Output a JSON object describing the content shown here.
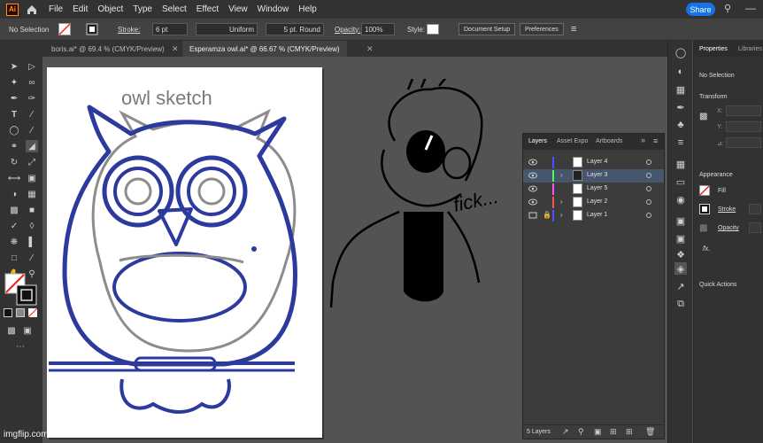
{
  "app": {
    "logo_text": "Ai"
  },
  "menu": [
    "File",
    "Edit",
    "Object",
    "Type",
    "Select",
    "Effect",
    "View",
    "Window",
    "Help"
  ],
  "share_label": "Share",
  "control_bar": {
    "selection": "No Selection",
    "stroke_label": "Stroke:",
    "stroke_weight": "6 pt",
    "profile": "Uniform",
    "brush": "5 pt. Round",
    "opacity_label": "Opacity:",
    "opacity": "100%",
    "style_label": "Style:",
    "document_setup": "Document Setup",
    "preferences": "Preferences"
  },
  "tabs": [
    {
      "label": "boris.ai* @ 69.4 % (CMYK/Preview)",
      "active": false
    },
    {
      "label": "Esperamza owl.ai* @ 66.67 % (CMYK/Preview)",
      "active": true
    }
  ],
  "artboard": {
    "title_text": "owl sketch"
  },
  "canvas": {
    "doodle_text": "fick..."
  },
  "properties": {
    "tab_properties": "Properties",
    "tab_libraries": "Libraries",
    "no_selection": "No Selection",
    "transform": "Transform",
    "x_label": "X:",
    "y_label": "Y:",
    "angle_label": "⊿:",
    "appearance": "Appearance",
    "fill": "Fill",
    "stroke": "Stroke",
    "opacity": "Opacity",
    "fx": "fx.",
    "quick_actions": "Quick Actions"
  },
  "layers_panel": {
    "tabs": [
      "Layers",
      "Asset Expo",
      "Artboards"
    ],
    "rows": [
      {
        "name": "Layer 4",
        "color": "#4f4fff",
        "selected": false,
        "locked": false,
        "expand": false
      },
      {
        "name": "Layer 3",
        "color": "#4fff4f",
        "selected": true,
        "locked": false,
        "expand": true
      },
      {
        "name": "Layer 5",
        "color": "#ff4fff",
        "selected": false,
        "locked": false,
        "expand": false
      },
      {
        "name": "Layer 2",
        "color": "#ff4f4f",
        "selected": false,
        "locked": false,
        "expand": true
      },
      {
        "name": "Layer 1",
        "color": "#4f4fff",
        "selected": false,
        "locked": true,
        "expand": true
      }
    ],
    "footer": "5 Layers"
  },
  "watermark": "imgflip.com",
  "colors": {
    "accent": "#1473e6",
    "owl_blue": "#2b3a9c",
    "sketch_gray": "#8c8c8c"
  }
}
